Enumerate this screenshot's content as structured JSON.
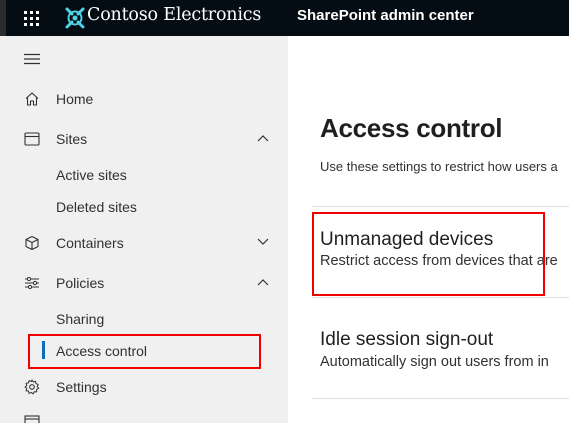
{
  "topbar": {
    "brand": "Contoso Electronics",
    "product": "SharePoint admin center",
    "icons": [
      "app-launcher-icon",
      "contoso-logo-icon"
    ]
  },
  "nav": {
    "menu_icon": "hamburger-menu-icon",
    "items": [
      {
        "label": "Home",
        "icon": "home-icon"
      },
      {
        "label": "Sites",
        "icon": "sites-icon",
        "expanded": true,
        "children": [
          {
            "label": "Active sites"
          },
          {
            "label": "Deleted sites"
          }
        ]
      },
      {
        "label": "Containers",
        "icon": "containers-icon",
        "expanded": false
      },
      {
        "label": "Policies",
        "icon": "policies-icon",
        "expanded": true,
        "children": [
          {
            "label": "Sharing"
          },
          {
            "label": "Access control",
            "selected": true
          }
        ]
      },
      {
        "label": "Settings",
        "icon": "settings-icon"
      }
    ]
  },
  "main": {
    "title": "Access control",
    "description": "Use these settings to restrict how users a",
    "sections": [
      {
        "title": "Unmanaged devices",
        "description": "Restrict access from devices that are"
      },
      {
        "title": "Idle session sign-out",
        "description": "Automatically sign out users from in"
      }
    ]
  },
  "colors": {
    "topbar": "#040d13",
    "nav_background": "#f0f0f0",
    "selection_bar": "#0f6cbd",
    "highlight": "#f20000"
  }
}
